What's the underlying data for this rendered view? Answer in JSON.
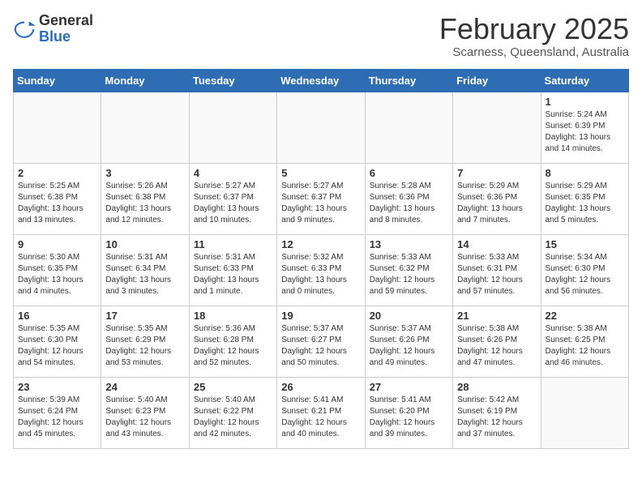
{
  "header": {
    "logo_general": "General",
    "logo_blue": "Blue",
    "month": "February 2025",
    "location": "Scarness, Queensland, Australia"
  },
  "weekdays": [
    "Sunday",
    "Monday",
    "Tuesday",
    "Wednesday",
    "Thursday",
    "Friday",
    "Saturday"
  ],
  "weeks": [
    [
      {
        "day": "",
        "info": ""
      },
      {
        "day": "",
        "info": ""
      },
      {
        "day": "",
        "info": ""
      },
      {
        "day": "",
        "info": ""
      },
      {
        "day": "",
        "info": ""
      },
      {
        "day": "",
        "info": ""
      },
      {
        "day": "1",
        "info": "Sunrise: 5:24 AM\nSunset: 6:39 PM\nDaylight: 13 hours\nand 14 minutes."
      }
    ],
    [
      {
        "day": "2",
        "info": "Sunrise: 5:25 AM\nSunset: 6:38 PM\nDaylight: 13 hours\nand 13 minutes."
      },
      {
        "day": "3",
        "info": "Sunrise: 5:26 AM\nSunset: 6:38 PM\nDaylight: 13 hours\nand 12 minutes."
      },
      {
        "day": "4",
        "info": "Sunrise: 5:27 AM\nSunset: 6:37 PM\nDaylight: 13 hours\nand 10 minutes."
      },
      {
        "day": "5",
        "info": "Sunrise: 5:27 AM\nSunset: 6:37 PM\nDaylight: 13 hours\nand 9 minutes."
      },
      {
        "day": "6",
        "info": "Sunrise: 5:28 AM\nSunset: 6:36 PM\nDaylight: 13 hours\nand 8 minutes."
      },
      {
        "day": "7",
        "info": "Sunrise: 5:29 AM\nSunset: 6:36 PM\nDaylight: 13 hours\nand 7 minutes."
      },
      {
        "day": "8",
        "info": "Sunrise: 5:29 AM\nSunset: 6:35 PM\nDaylight: 13 hours\nand 5 minutes."
      }
    ],
    [
      {
        "day": "9",
        "info": "Sunrise: 5:30 AM\nSunset: 6:35 PM\nDaylight: 13 hours\nand 4 minutes."
      },
      {
        "day": "10",
        "info": "Sunrise: 5:31 AM\nSunset: 6:34 PM\nDaylight: 13 hours\nand 3 minutes."
      },
      {
        "day": "11",
        "info": "Sunrise: 5:31 AM\nSunset: 6:33 PM\nDaylight: 13 hours\nand 1 minute."
      },
      {
        "day": "12",
        "info": "Sunrise: 5:32 AM\nSunset: 6:33 PM\nDaylight: 13 hours\nand 0 minutes."
      },
      {
        "day": "13",
        "info": "Sunrise: 5:33 AM\nSunset: 6:32 PM\nDaylight: 12 hours\nand 59 minutes."
      },
      {
        "day": "14",
        "info": "Sunrise: 5:33 AM\nSunset: 6:31 PM\nDaylight: 12 hours\nand 57 minutes."
      },
      {
        "day": "15",
        "info": "Sunrise: 5:34 AM\nSunset: 6:30 PM\nDaylight: 12 hours\nand 56 minutes."
      }
    ],
    [
      {
        "day": "16",
        "info": "Sunrise: 5:35 AM\nSunset: 6:30 PM\nDaylight: 12 hours\nand 54 minutes."
      },
      {
        "day": "17",
        "info": "Sunrise: 5:35 AM\nSunset: 6:29 PM\nDaylight: 12 hours\nand 53 minutes."
      },
      {
        "day": "18",
        "info": "Sunrise: 5:36 AM\nSunset: 6:28 PM\nDaylight: 12 hours\nand 52 minutes."
      },
      {
        "day": "19",
        "info": "Sunrise: 5:37 AM\nSunset: 6:27 PM\nDaylight: 12 hours\nand 50 minutes."
      },
      {
        "day": "20",
        "info": "Sunrise: 5:37 AM\nSunset: 6:26 PM\nDaylight: 12 hours\nand 49 minutes."
      },
      {
        "day": "21",
        "info": "Sunrise: 5:38 AM\nSunset: 6:26 PM\nDaylight: 12 hours\nand 47 minutes."
      },
      {
        "day": "22",
        "info": "Sunrise: 5:38 AM\nSunset: 6:25 PM\nDaylight: 12 hours\nand 46 minutes."
      }
    ],
    [
      {
        "day": "23",
        "info": "Sunrise: 5:39 AM\nSunset: 6:24 PM\nDaylight: 12 hours\nand 45 minutes."
      },
      {
        "day": "24",
        "info": "Sunrise: 5:40 AM\nSunset: 6:23 PM\nDaylight: 12 hours\nand 43 minutes."
      },
      {
        "day": "25",
        "info": "Sunrise: 5:40 AM\nSunset: 6:22 PM\nDaylight: 12 hours\nand 42 minutes."
      },
      {
        "day": "26",
        "info": "Sunrise: 5:41 AM\nSunset: 6:21 PM\nDaylight: 12 hours\nand 40 minutes."
      },
      {
        "day": "27",
        "info": "Sunrise: 5:41 AM\nSunset: 6:20 PM\nDaylight: 12 hours\nand 39 minutes."
      },
      {
        "day": "28",
        "info": "Sunrise: 5:42 AM\nSunset: 6:19 PM\nDaylight: 12 hours\nand 37 minutes."
      },
      {
        "day": "",
        "info": ""
      }
    ]
  ]
}
